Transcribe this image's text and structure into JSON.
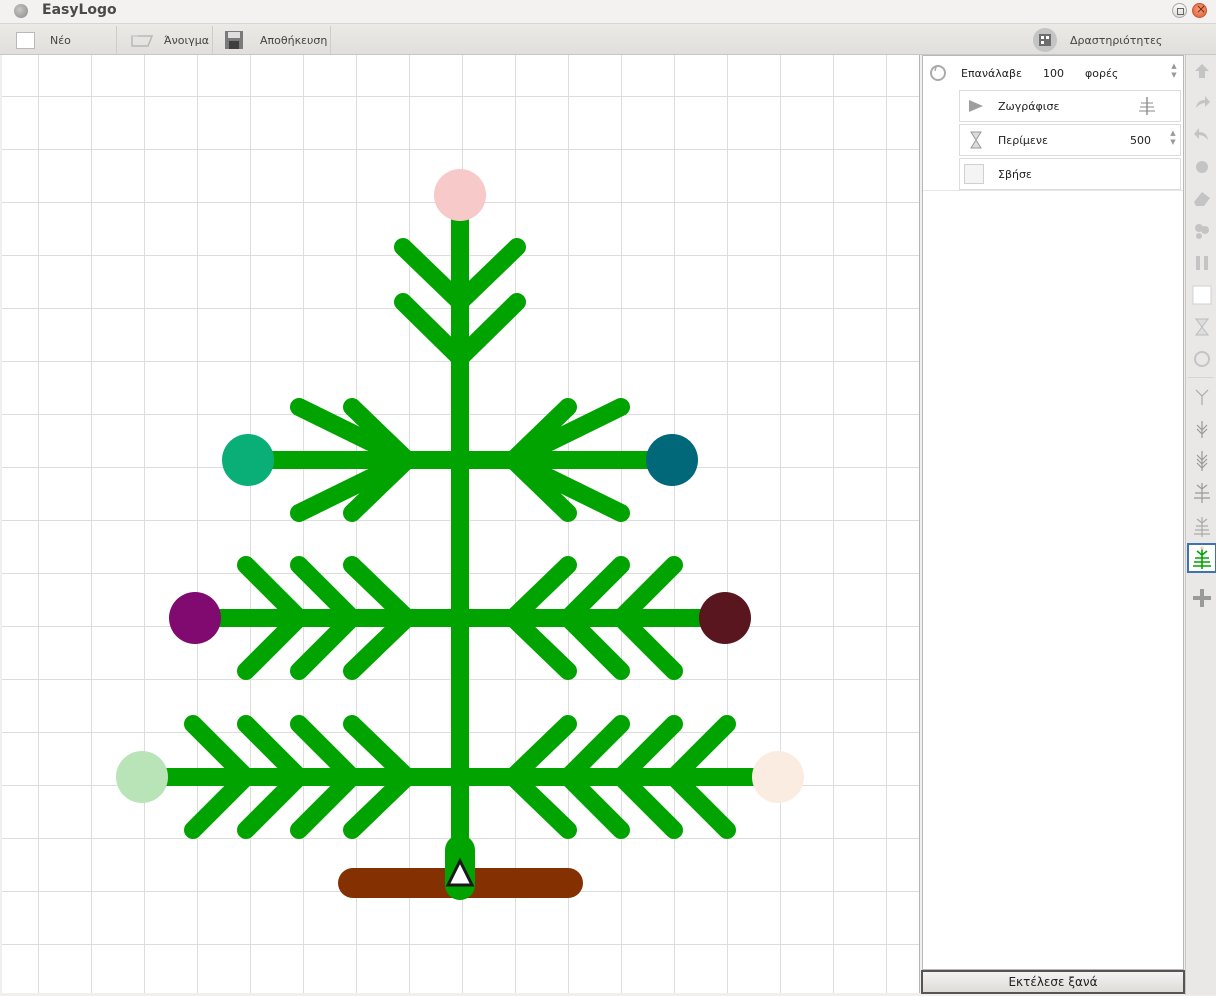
{
  "window": {
    "title": "EasyLogo"
  },
  "toolbar": {
    "new_label": "Νέο",
    "open_label": "Άνοιγμα",
    "save_label": "Αποθήκευση",
    "activities_label": "Δραστηριότητες"
  },
  "program": {
    "repeat_label": "Επανάλαβε",
    "repeat_count": "100",
    "repeat_unit": "φορές",
    "draw_label": "Ζωγράφισε",
    "wait_label": "Περίμενε",
    "wait_value": "500",
    "clear_label": "Σβήσε"
  },
  "run_again_label": "Εκτέλεσε ξανά",
  "colors": {
    "branch": "#00a300",
    "trunk_base": "#843000",
    "ornaments": [
      "#f7c9c9",
      "#0aaf78",
      "#006878",
      "#800a70",
      "#5a161e",
      "#b8e4b8",
      "#fbece2"
    ],
    "selection": "#3c73b0"
  },
  "sidebar_icons": [
    "arrow-up-icon",
    "redo-icon",
    "undo-icon",
    "dot-icon",
    "eraser-icon",
    "shapes-icon",
    "pause-icon",
    "square-icon",
    "hourglass-icon",
    "repeat-icon",
    "tree-step1-icon",
    "tree-step2-icon",
    "tree-step3-icon",
    "tree-step4-icon",
    "tree-step5-icon",
    "tree-step6-icon",
    "add-icon"
  ]
}
